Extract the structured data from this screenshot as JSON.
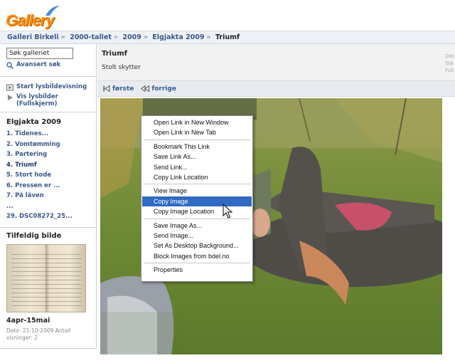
{
  "header": {
    "logo_text": "Gallery"
  },
  "breadcrumb": {
    "items": [
      "Galleri Birkeli",
      "2000-tallet",
      "2009",
      "Elgjakta 2009"
    ],
    "current": "Triumf",
    "separator": "»"
  },
  "sidebar": {
    "search": {
      "value": "Søk galleriet"
    },
    "advanced_search": "Avansert søk",
    "slideshow": "Start lysbildevisning",
    "fullscreen": "Vis lysbilder (Fullskjerm)",
    "album_title": "Elgjakta 2009",
    "album_items": [
      "1. Tidenes...",
      "2. Vomtømming",
      "3. Partering",
      "4. Triumf",
      "5. Stort hode",
      "6. Pressen er ...",
      "7. På låven",
      "...",
      "29. DSC08272_25..."
    ],
    "random_heading": "Tilfeldig bilde",
    "random_title": "4apr-15mai",
    "random_meta": "Dato: 21-10-2009 Antall visninger: 2"
  },
  "photo": {
    "title": "Triumf",
    "caption": "Stolt skytter",
    "side_meta": [
      "Dat",
      "Stø",
      "Full"
    ]
  },
  "pager": {
    "first": "første",
    "prev": "forrige"
  },
  "context_menu": {
    "groups": [
      [
        "Open Link in New Window",
        "Open Link in New Tab"
      ],
      [
        "Bookmark This Link",
        "Save Link As...",
        "Send Link...",
        "Copy Link Location"
      ],
      [
        "View Image",
        "Copy Image",
        "Copy Image Location"
      ],
      [
        "Save Image As...",
        "Send Image...",
        "Set As Desktop Background...",
        "Block Images from bdel.no"
      ],
      [
        "Properties"
      ]
    ],
    "highlighted": "Copy Image"
  },
  "colors": {
    "link": "#3a5a8c",
    "highlight": "#316ac5",
    "logo": "#ff8a00"
  }
}
